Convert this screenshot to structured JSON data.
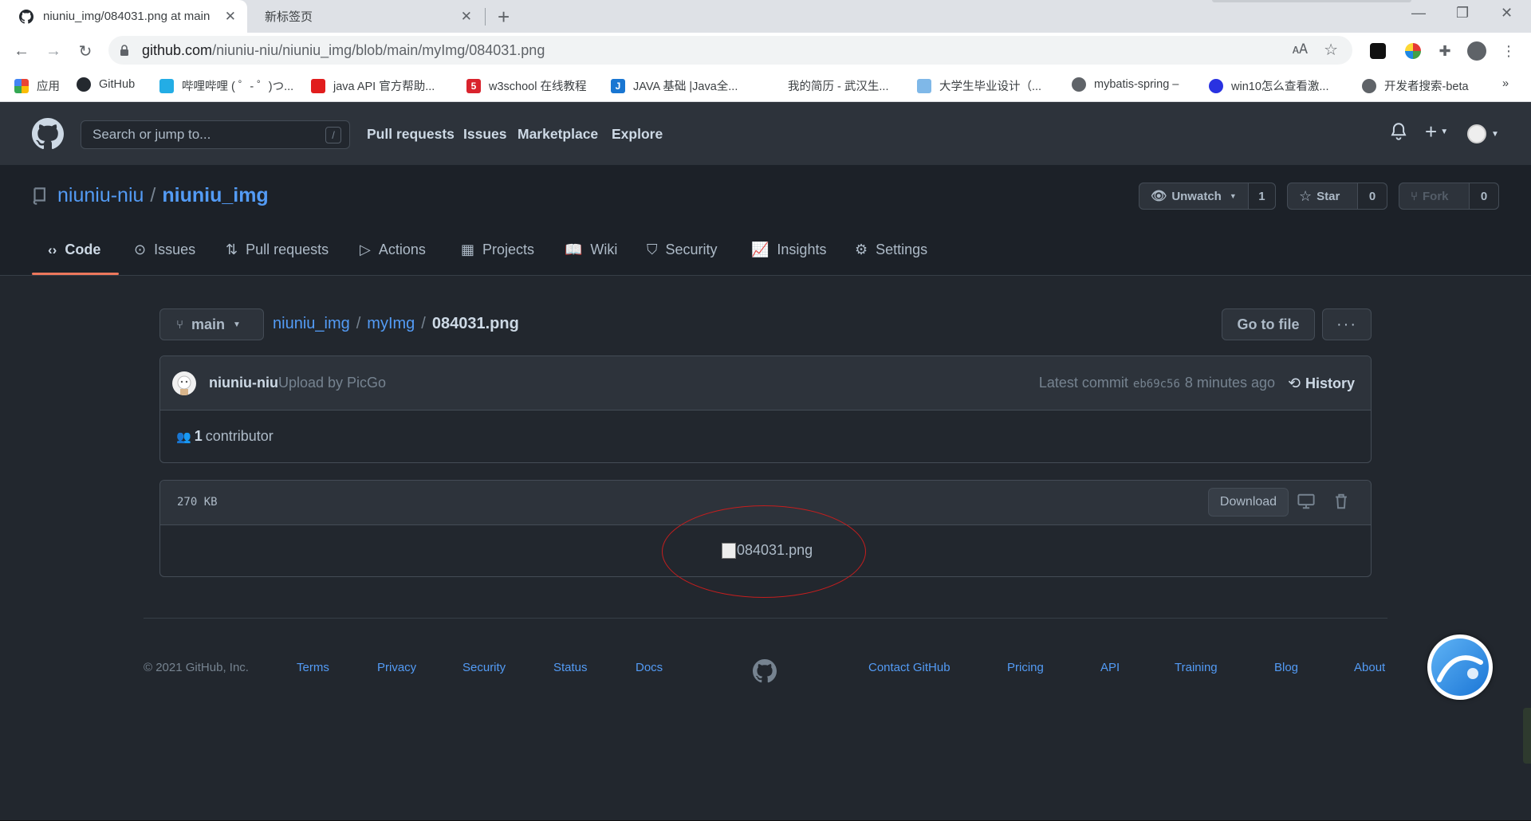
{
  "browser": {
    "active_tab_title": "niuniu_img/084031.png at main",
    "inactive_tab_title": "新标签页",
    "url_host": "github.com",
    "url_path": "/niuniu-niu/niuniu_img/blob/main/myImg/084031.png",
    "bookmarks": [
      {
        "label": "应用",
        "icon": "apps-grid-icon"
      },
      {
        "label": "GitHub",
        "icon": "github-icon"
      },
      {
        "label": "哔哩哔哩 ( ゜- ゜)つ...",
        "icon": "bilibili-icon"
      },
      {
        "label": "java API 官方帮助...",
        "icon": "oracle-icon"
      },
      {
        "label": "w3school 在线教程",
        "icon": "w3school-icon"
      },
      {
        "label": "JAVA 基础 |Java全...",
        "icon": "j-icon"
      },
      {
        "label": "我的简历 - 武汉生...",
        "icon": "blank-icon"
      },
      {
        "label": "大学生毕业设计（...",
        "icon": "cloud-icon"
      },
      {
        "label": "mybatis-spring –",
        "icon": "globe-icon"
      },
      {
        "label": "win10怎么查看激...",
        "icon": "baidu-paw-icon"
      },
      {
        "label": "开发者搜索-beta",
        "icon": "globe-icon"
      }
    ],
    "bookmarks_more": "»"
  },
  "github": {
    "search_placeholder": "Search or jump to...",
    "search_key": "/",
    "nav": [
      "Pull requests",
      "Issues",
      "Marketplace",
      "Explore"
    ]
  },
  "repo": {
    "owner": "niuniu-niu",
    "separator": "/",
    "name": "niuniu_img",
    "watch_label": "Unwatch",
    "watch_count": "1",
    "star_label": "Star",
    "star_count": "0",
    "fork_label": "Fork",
    "fork_count": "0",
    "tabs": [
      "Code",
      "Issues",
      "Pull requests",
      "Actions",
      "Projects",
      "Wiki",
      "Security",
      "Insights",
      "Settings"
    ]
  },
  "file": {
    "branch": "main",
    "crumb_repo": "niuniu_img",
    "crumb_dir": "myImg",
    "crumb_file": "084031.png",
    "goto_label": "Go to file",
    "more_label": "···",
    "commit_author": "niuniu-niu",
    "commit_message": "Upload by PicGo",
    "latest_commit_label": "Latest commit",
    "commit_sha": "eb69c56",
    "commit_time": "8 minutes ago",
    "history_label": "History",
    "contributor_count": "1",
    "contributor_label": "contributor",
    "size": "270 KB",
    "download_label": "Download",
    "image_alt": "084031.png"
  },
  "footer": {
    "copyright": "© 2021 GitHub, Inc.",
    "left_links": [
      "Terms",
      "Privacy",
      "Security",
      "Status",
      "Docs"
    ],
    "right_links": [
      "Contact GitHub",
      "Pricing",
      "API",
      "Training",
      "Blog",
      "About"
    ]
  },
  "colors": {
    "background": "#22272e",
    "header": "#2d333b",
    "link": "#539bf5",
    "tab_underline": "#ec775c",
    "annotation": "#c41e1e"
  }
}
